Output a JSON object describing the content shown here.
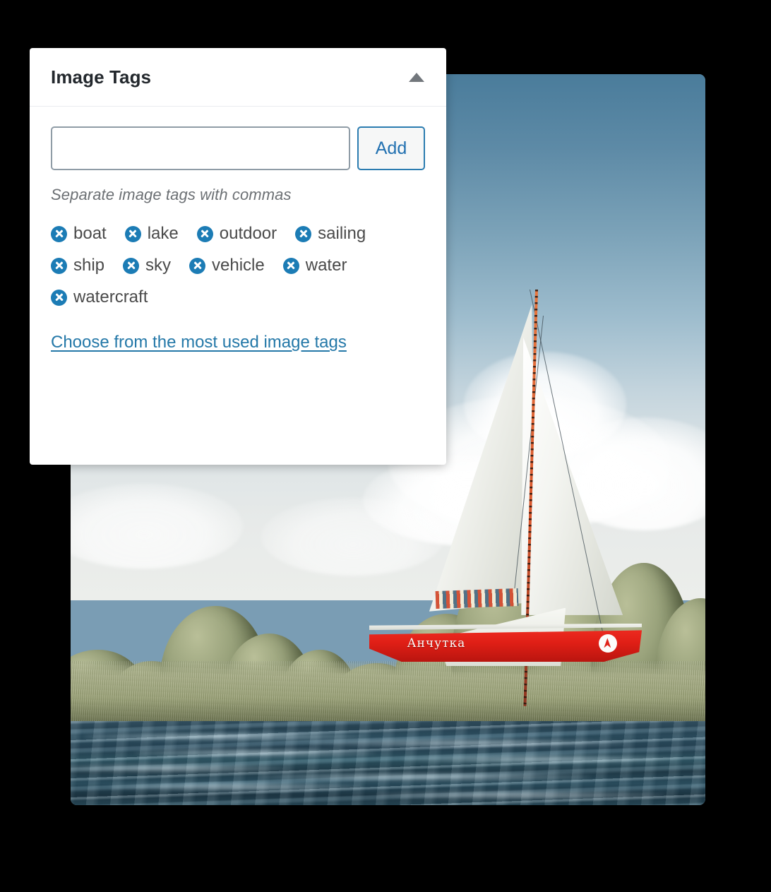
{
  "panel": {
    "title": "Image Tags",
    "collapse_icon": "caret-up-icon",
    "input": {
      "value": "",
      "placeholder": ""
    },
    "add_label": "Add",
    "hint": "Separate image tags with commas",
    "tags": [
      {
        "label": "boat",
        "remove_icon": "remove-tag-icon"
      },
      {
        "label": "lake",
        "remove_icon": "remove-tag-icon"
      },
      {
        "label": "outdoor",
        "remove_icon": "remove-tag-icon"
      },
      {
        "label": "sailing",
        "remove_icon": "remove-tag-icon"
      },
      {
        "label": "ship",
        "remove_icon": "remove-tag-icon"
      },
      {
        "label": "sky",
        "remove_icon": "remove-tag-icon"
      },
      {
        "label": "vehicle",
        "remove_icon": "remove-tag-icon"
      },
      {
        "label": "water",
        "remove_icon": "remove-tag-icon"
      },
      {
        "label": "watercraft",
        "remove_icon": "remove-tag-icon"
      }
    ],
    "most_used_link": "Choose from the most used image tags"
  },
  "photo": {
    "boat_name": "Анчутка",
    "alt": "Red sailboat on a lake with white sails, trees on the shore and blue water"
  },
  "colors": {
    "accent": "#2271b1",
    "tag_icon": "#1c7cb5",
    "link": "#2478a8",
    "title": "#23282d",
    "hull_red": "#e01f16",
    "background": "#000000"
  }
}
